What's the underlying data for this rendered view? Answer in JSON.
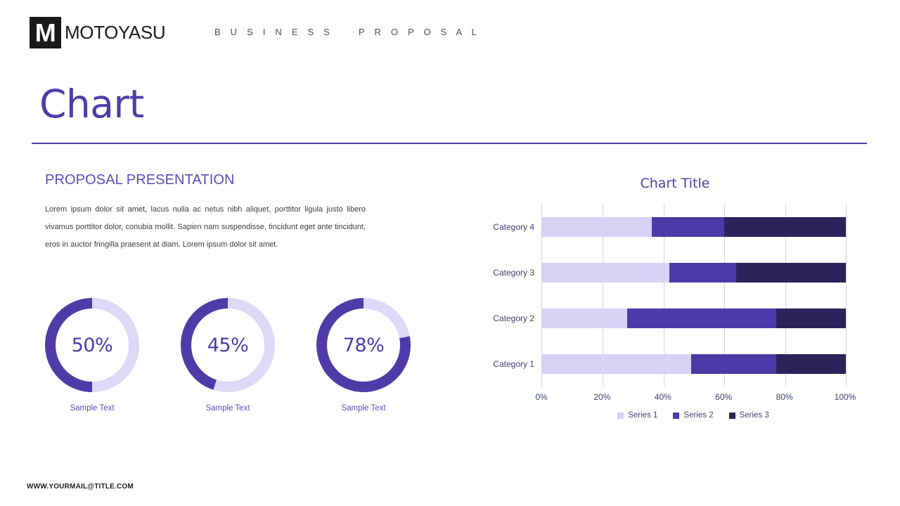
{
  "header": {
    "logo_letter": "M",
    "brand_name": "MOTOYASU",
    "tag_left": "B U S I N E S S",
    "tag_right": "P R O P O S A L"
  },
  "page_title": "Chart",
  "left": {
    "section_heading": "PROPOSAL PRESENTATION",
    "paragraph": "Lorem ipsum dolor sit amet, lacus nulla ac netus nibh aliquet, porttitor ligula justo libero vivamus porttitor dolor, conubia mollit. Sapien nam suspendisse, tincidunt eget ante tincidunt, eros in auctor fringilla praesent at diam. Lorem ipsum dolor sit amet."
  },
  "donuts": [
    {
      "value_label": "50%",
      "percent": 50,
      "caption": "Sample Text"
    },
    {
      "value_label": "45%",
      "percent": 45,
      "caption": "Sample Text"
    },
    {
      "value_label": "78%",
      "percent": 78,
      "caption": "Sample Text"
    }
  ],
  "colors": {
    "accent": "#4f3ba8",
    "series1": "#d6d2f5",
    "series2": "#4b3aa8",
    "series3": "#2c235c",
    "donut_track": "#ddd9f7",
    "gridline": "#d4d4e4",
    "header_tag": "#4c5246"
  },
  "chart_data": {
    "type": "bar",
    "title": "Chart Title",
    "orientation": "horizontal",
    "stacked": true,
    "stack_mode": "percent",
    "categories": [
      "Category 1",
      "Category 2",
      "Category 3",
      "Category 4"
    ],
    "series": [
      {
        "name": "Series 1",
        "color": "#d6d2f5",
        "values": [
          49,
          28,
          42,
          36
        ]
      },
      {
        "name": "Series 2",
        "color": "#4b3aa8",
        "values": [
          28,
          49,
          22,
          24
        ]
      },
      {
        "name": "Series 3",
        "color": "#2c235c",
        "values": [
          23,
          23,
          36,
          40
        ]
      }
    ],
    "xlabel": "",
    "ylabel": "",
    "xlim": [
      0,
      100
    ],
    "xticks": [
      "0%",
      "20%",
      "40%",
      "60%",
      "80%",
      "100%"
    ],
    "xtick_values": [
      0,
      20,
      40,
      60,
      80,
      100
    ],
    "grid": true,
    "legend_position": "bottom"
  },
  "footer": "WWW.YOURMAIL@TITLE.COM"
}
